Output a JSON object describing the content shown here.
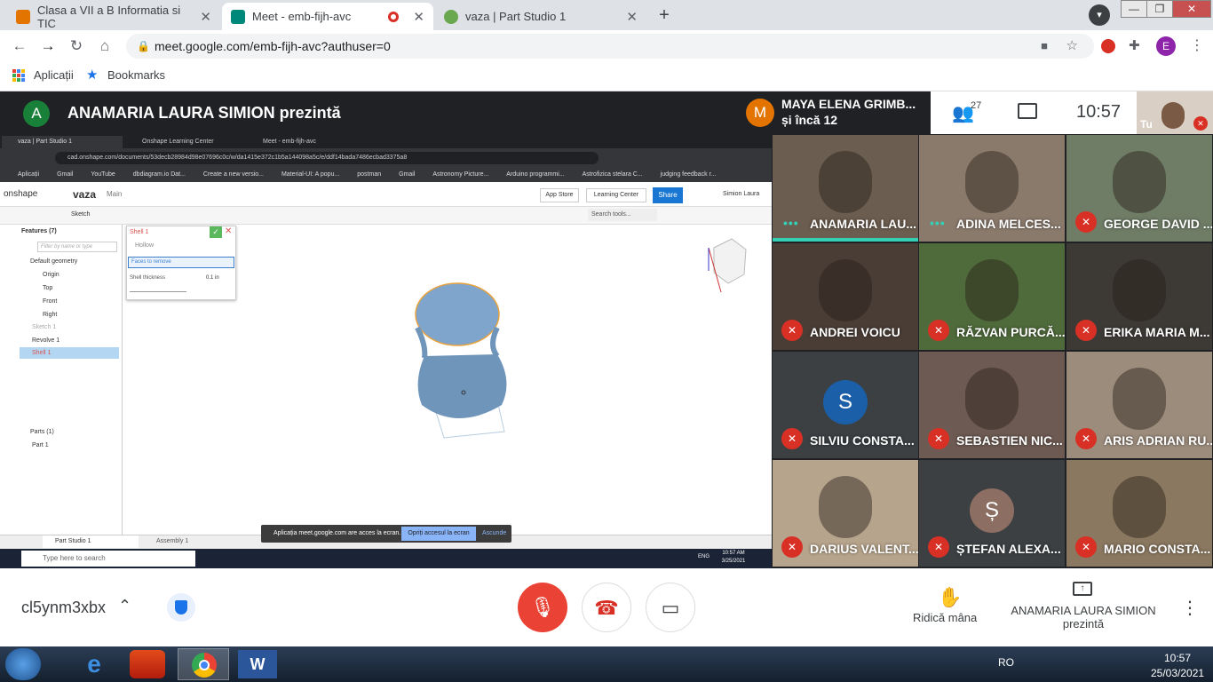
{
  "browser": {
    "tabs": [
      {
        "title": "Clasa a VII a B Informatia si TIC",
        "icon": "classroom-icon",
        "color": "#e37400"
      },
      {
        "title": "Meet - emb-fijh-avc",
        "icon": "meet-icon",
        "color": "#00897b"
      },
      {
        "title": "vaza | Part Studio 1",
        "icon": "onshape-icon",
        "color": "#6aa84f"
      }
    ],
    "close_glyph": "✕",
    "new_tab_glyph": "+",
    "url": "meet.google.com/emb-fijh-avc?authuser=0",
    "profile_initial": "E",
    "bookmarks": {
      "apps": "Aplicații",
      "bookmarks": "Bookmarks"
    }
  },
  "meet": {
    "presenter_initial": "A",
    "presenter_title": "ANAMARIA LAURA SIMION prezintă",
    "speaker_initial": "M",
    "speaker_name": "MAYA ELENA GRIMB...",
    "speaker_more": "și încă 12",
    "participant_count": "27",
    "clock": "10:57",
    "self_label": "Tu",
    "tiles": [
      {
        "name": "ANAMARIA LAU...",
        "state": "speaking",
        "bg": "#6b5d4f"
      },
      {
        "name": "ADINA MELCES...",
        "state": "speaking",
        "bg": "#8a7a6c"
      },
      {
        "name": "GEORGE DAVID ...",
        "state": "muted",
        "bg": "#6f7d67"
      },
      {
        "name": "ANDREI VOICU",
        "state": "muted",
        "bg": "#4a3d36"
      },
      {
        "name": "RĂZVAN PURCĂ...",
        "state": "muted",
        "bg": "#4f6a3b"
      },
      {
        "name": "ERIKA MARIA M...",
        "state": "muted",
        "bg": "#3d3a36"
      },
      {
        "name": "SILVIU CONSTA...",
        "state": "muted",
        "bg": "#3c4043",
        "initial": "S",
        "avatar_color": "#1a5fa8"
      },
      {
        "name": "SEBASTIEN NIC...",
        "state": "muted",
        "bg": "#6d5a52"
      },
      {
        "name": "ARIS ADRIAN RU...",
        "state": "muted",
        "bg": "#9c8c7c"
      },
      {
        "name": "DARIUS VALENT...",
        "state": "muted",
        "bg": "#b7a48c"
      },
      {
        "name": "ȘTEFAN ALEXA...",
        "state": "muted",
        "bg": "#3c4043",
        "initial": "Ș",
        "avatar_color": "#8d6e63"
      },
      {
        "name": "MARIO CONSTA...",
        "state": "muted",
        "bg": "#8a7860"
      }
    ],
    "meeting_code": "cl5ynm3xbx",
    "raise_hand": "Ridică mâna",
    "presenting_line1": "ANAMARIA LAURA SIMION",
    "presenting_line2": "prezintă"
  },
  "shared": {
    "tabs": [
      "vaza | Part Studio 1",
      "Onshape Learning Center",
      "Meet - emb-fijh-avc"
    ],
    "url": "cad.onshape.com/documents/53decb28984d98e07696c0c/w/da1415e372c1b5a144098a5c/e/ddf14bada7486ecbad3375a8",
    "bookmarks": [
      "Aplicații",
      "Gmail",
      "YouTube",
      "dbdiagram.io  Dat...",
      "Create a new versio...",
      "Material-UI: A popu...",
      "postman",
      "Gmail",
      "Astronomy Picture...",
      "Arduino programmi...",
      "Astrofizica stelara C...",
      "judging feedback r..."
    ],
    "app": "onshape",
    "doc": "vaza",
    "branch": "Main",
    "app_store": "App Store",
    "learning": "Learning Center",
    "share": "Share",
    "user": "Simion Laura",
    "search": "Search tools...",
    "sketch": "Sketch",
    "features_title": "Features (7)",
    "filter": "Filter by name or type",
    "tree": [
      "Default geometry",
      "Origin",
      "Top",
      "Front",
      "Right",
      "Sketch 1",
      "Revolve 1",
      "Shell 1"
    ],
    "parts_title": "Parts (1)",
    "part": "Part 1",
    "dlg_title": "Shell 1",
    "dlg_hollow": "Hollow",
    "dlg_faces": "Faces to remove",
    "dlg_thick": "Shell thickness",
    "dlg_value": "0.1 in",
    "tab_part": "Part Studio 1",
    "tab_asm": "Assembly 1",
    "share_msg": "Aplicația meet.google.com are acces la ecran.",
    "share_stop": "Opriți accesul la ecran",
    "share_hide": "Ascunde",
    "win_search": "Type here to search",
    "win_lang": "ENG",
    "win_time": "10:57 AM",
    "win_date": "3/25/2021"
  },
  "taskbar": {
    "lang": "RO",
    "time": "10:57",
    "date": "25/03/2021"
  }
}
